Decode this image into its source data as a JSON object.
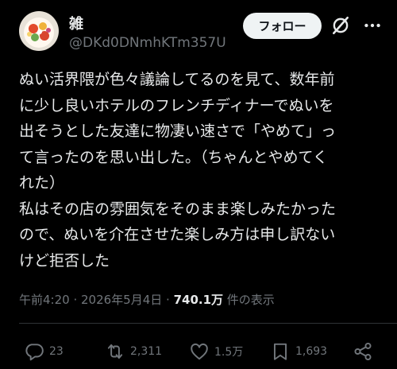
{
  "user": {
    "display_name": "雑",
    "handle": "@DKd0DNmhKTm357U"
  },
  "header": {
    "follow_label": "フォロー",
    "grok_icon": "grok-slash-circle-icon",
    "more_icon": "more-dots-icon"
  },
  "post": {
    "text": "ぬい活界隈が色々議論してるのを見て、数年前\nに少し良いホテルのフレンチディナーでぬいを\n出そうとした友達に物凄い速さで「やめて」っ\nて言ったのを思い出した。（ちゃんとやめてく\nれた）\n私はその店の雰囲気をそのまま楽しみたかった\nので、ぬいを介在させた楽しみ方は申し訳ない\nけど拒否した"
  },
  "meta": {
    "time": "午前4:20",
    "separator1": " · ",
    "date": "2026年5月4日",
    "separator2": " · ",
    "views_count": "740.1万",
    "views_label": " 件の表示"
  },
  "actions": {
    "replies": "23",
    "reposts": "2,311",
    "likes": "1.5万",
    "bookmarks": "1,693"
  },
  "colors": {
    "background": "#000000",
    "text": "#e7e9ea",
    "muted": "#71767b",
    "follow_bg": "#eff3f4"
  }
}
